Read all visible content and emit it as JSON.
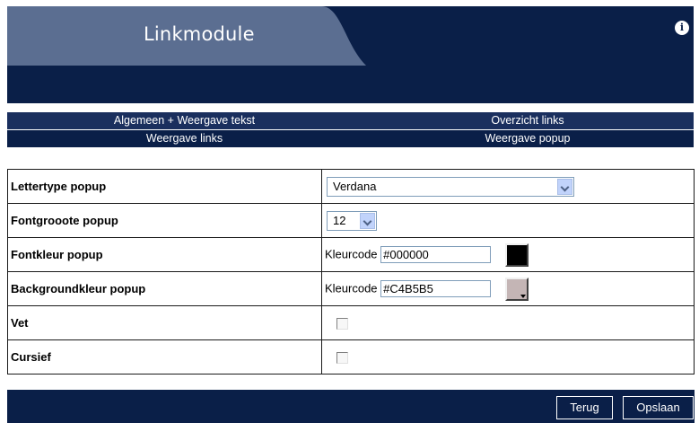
{
  "header": {
    "title": "Linkmodule",
    "icon": "info-icon"
  },
  "nav": {
    "row1": [
      "Algemeen + Weergave tekst",
      "Overzicht links"
    ],
    "row2": [
      "Weergave links",
      "Weergave popup"
    ]
  },
  "rows": {
    "font": {
      "label": "Lettertype popup",
      "value": "Verdana"
    },
    "fontsize": {
      "label": "Fontgrooote popup",
      "value": "12"
    },
    "fontcolor": {
      "label": "Fontkleur popup",
      "code_label": "Kleurcode",
      "value": "#000000",
      "swatch": "#000000"
    },
    "bgcolor": {
      "label": "Backgroundkleur popup",
      "code_label": "Kleurcode",
      "value": "#C4B5B5",
      "swatch": "#C4B5B5"
    },
    "bold": {
      "label": "Vet",
      "checked": false
    },
    "italic": {
      "label": "Cursief",
      "checked": false
    }
  },
  "buttons": {
    "back": "Terug",
    "save": "Opslaan"
  },
  "colors": {
    "dark_navy": "#0a1f48",
    "header_tab": "#5b6e91",
    "nav_row1": "#1a2f5e"
  }
}
